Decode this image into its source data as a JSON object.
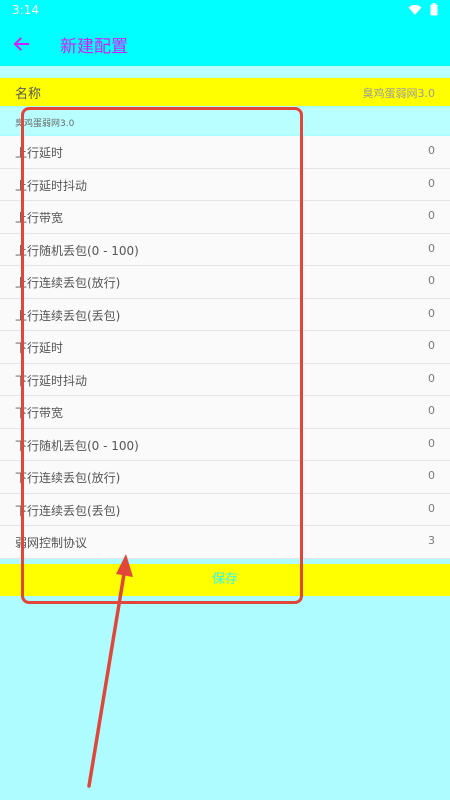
{
  "status_bar": {
    "time": "3:14",
    "wifi_icon": "wifi-icon",
    "battery_icon": "battery-icon"
  },
  "app_bar": {
    "back_icon": "arrow-left-icon",
    "title": "新建配置",
    "accent_color": "#d31fff",
    "background_color": "#00ffff"
  },
  "name_field": {
    "label": "名称",
    "value": "臭鸡蛋弱网3.0"
  },
  "caption": "臭鸡蛋弱网3.0",
  "items": [
    {
      "label": "上行延时",
      "value": "0"
    },
    {
      "label": "上行延时抖动",
      "value": "0"
    },
    {
      "label": "上行带宽",
      "value": "0"
    },
    {
      "label": "上行随机丢包(0 - 100)",
      "value": "0"
    },
    {
      "label": "上行连续丢包(放行)",
      "value": "0"
    },
    {
      "label": "上行连续丢包(丢包)",
      "value": "0"
    },
    {
      "label": "下行延时",
      "value": "0"
    },
    {
      "label": "下行延时抖动",
      "value": "0"
    },
    {
      "label": "下行带宽",
      "value": "0"
    },
    {
      "label": "下行随机丢包(0 - 100)",
      "value": "0"
    },
    {
      "label": "下行连续丢包(放行)",
      "value": "0"
    },
    {
      "label": "下行连续丢包(丢包)",
      "value": "0"
    },
    {
      "label": "弱网控制协议",
      "value": "3"
    }
  ],
  "save_button": {
    "label": "保存",
    "background_color": "#ffff00"
  },
  "annotation": {
    "color": "#e0463a"
  }
}
